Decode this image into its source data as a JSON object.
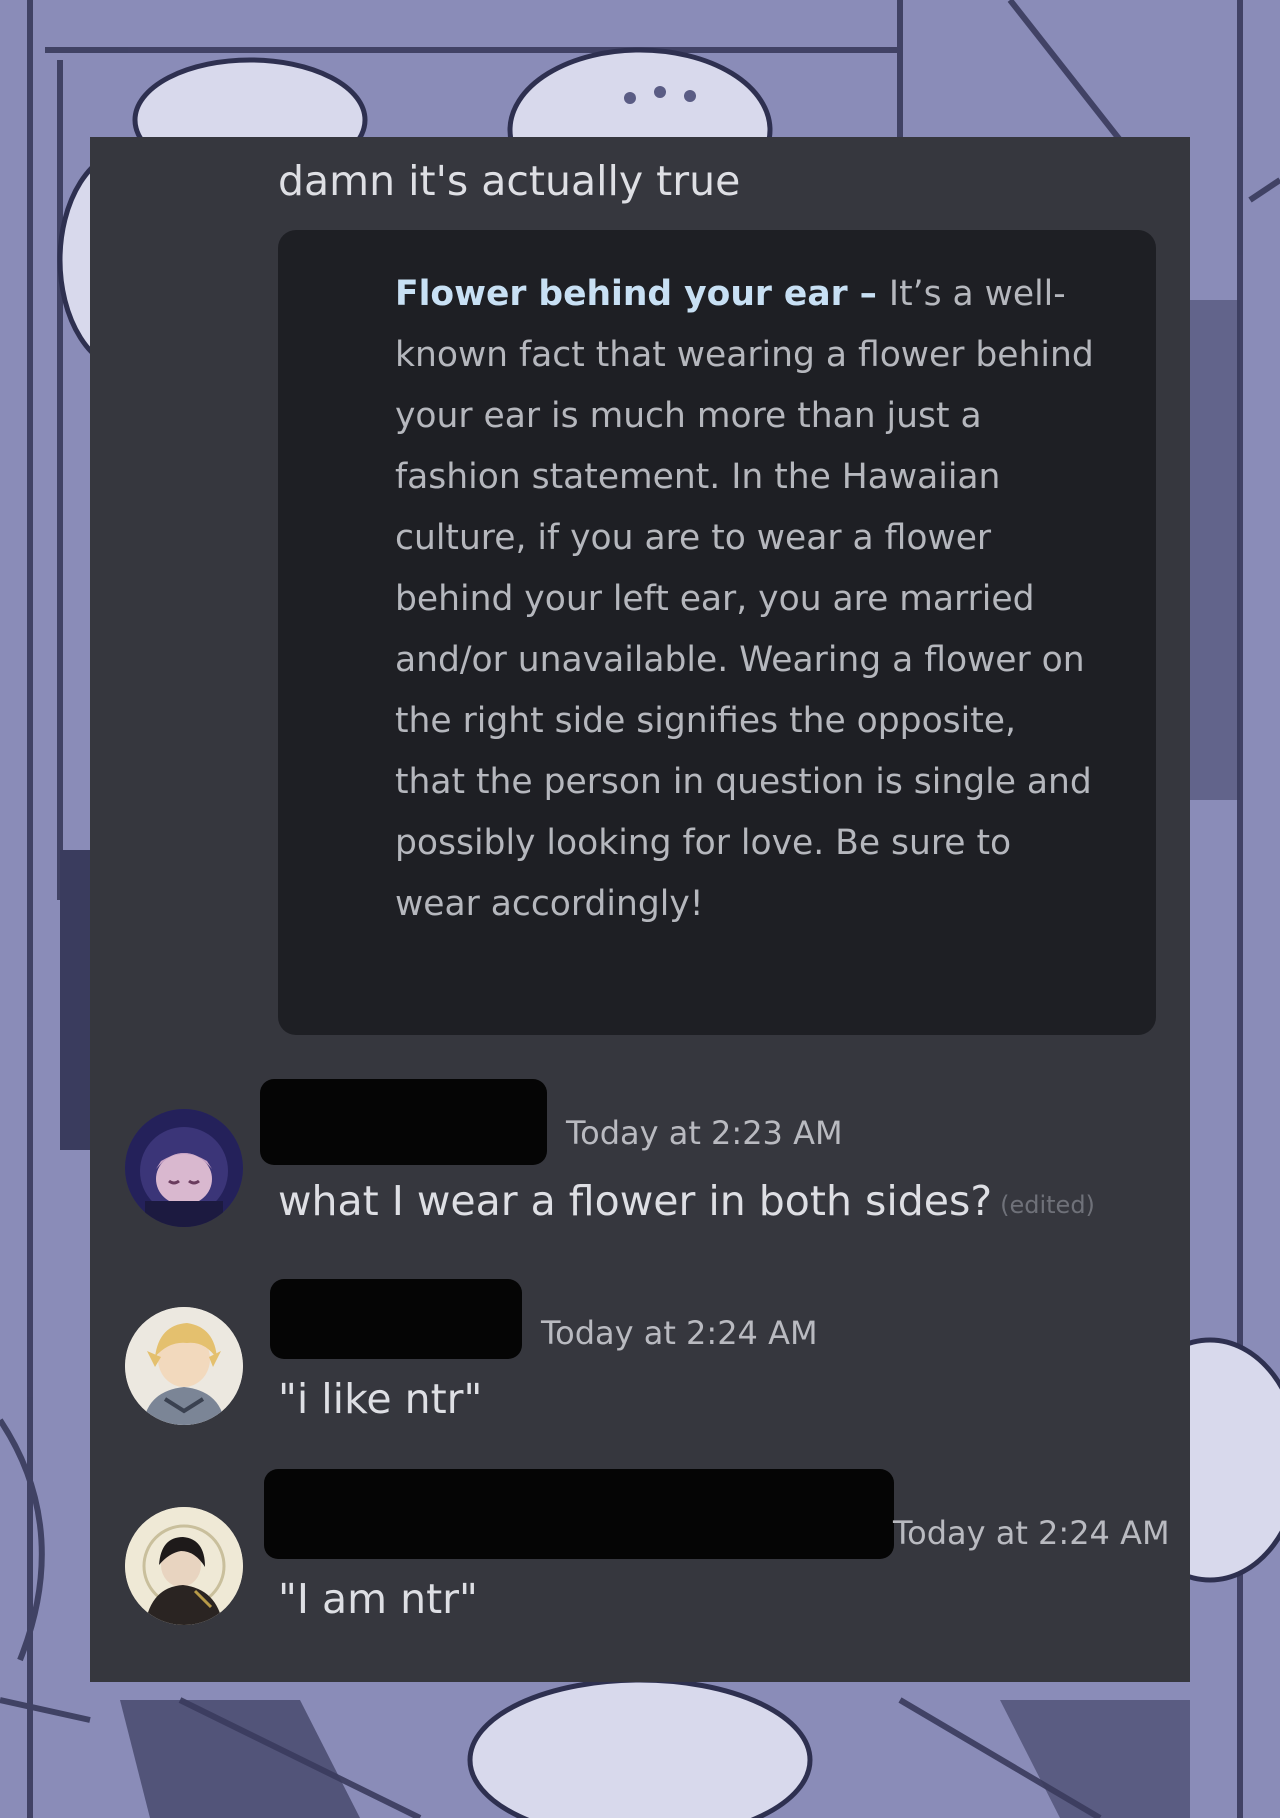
{
  "messages": [
    {
      "text": "damn it's actually true"
    }
  ],
  "embed": {
    "title": "Flower behind your ear",
    "separator": " – ",
    "body": "It’s a well-known fact that wearing a flower behind your ear is much more than just a fashion statement. In the Hawaiian culture, if you are to wear a flower behind your left ear, you are married and/or unavailable. Wearing a flower on the right side signifies the opposite, that the person in question is single and possibly looking for love. Be sure to wear accordingly!"
  },
  "posts": [
    {
      "timestamp": "Today at 2:23 AM",
      "text": "what I wear a flower in both sides?",
      "edited": "(edited)",
      "avatar": "purple-hooded-character-avatar"
    },
    {
      "timestamp": "Today at 2:24 AM",
      "text": "\"i like ntr\"",
      "avatar": "blonde-knight-avatar"
    },
    {
      "timestamp": "Today at 2:24 AM",
      "text": "\"I am ntr\"",
      "avatar": "dark-haired-character-avatar"
    }
  ],
  "colors": {
    "background": "#8a8cb4",
    "chat_bg": "#36373e",
    "embed_bg": "#1e1f24",
    "embed_title": "#c8e0f4"
  }
}
